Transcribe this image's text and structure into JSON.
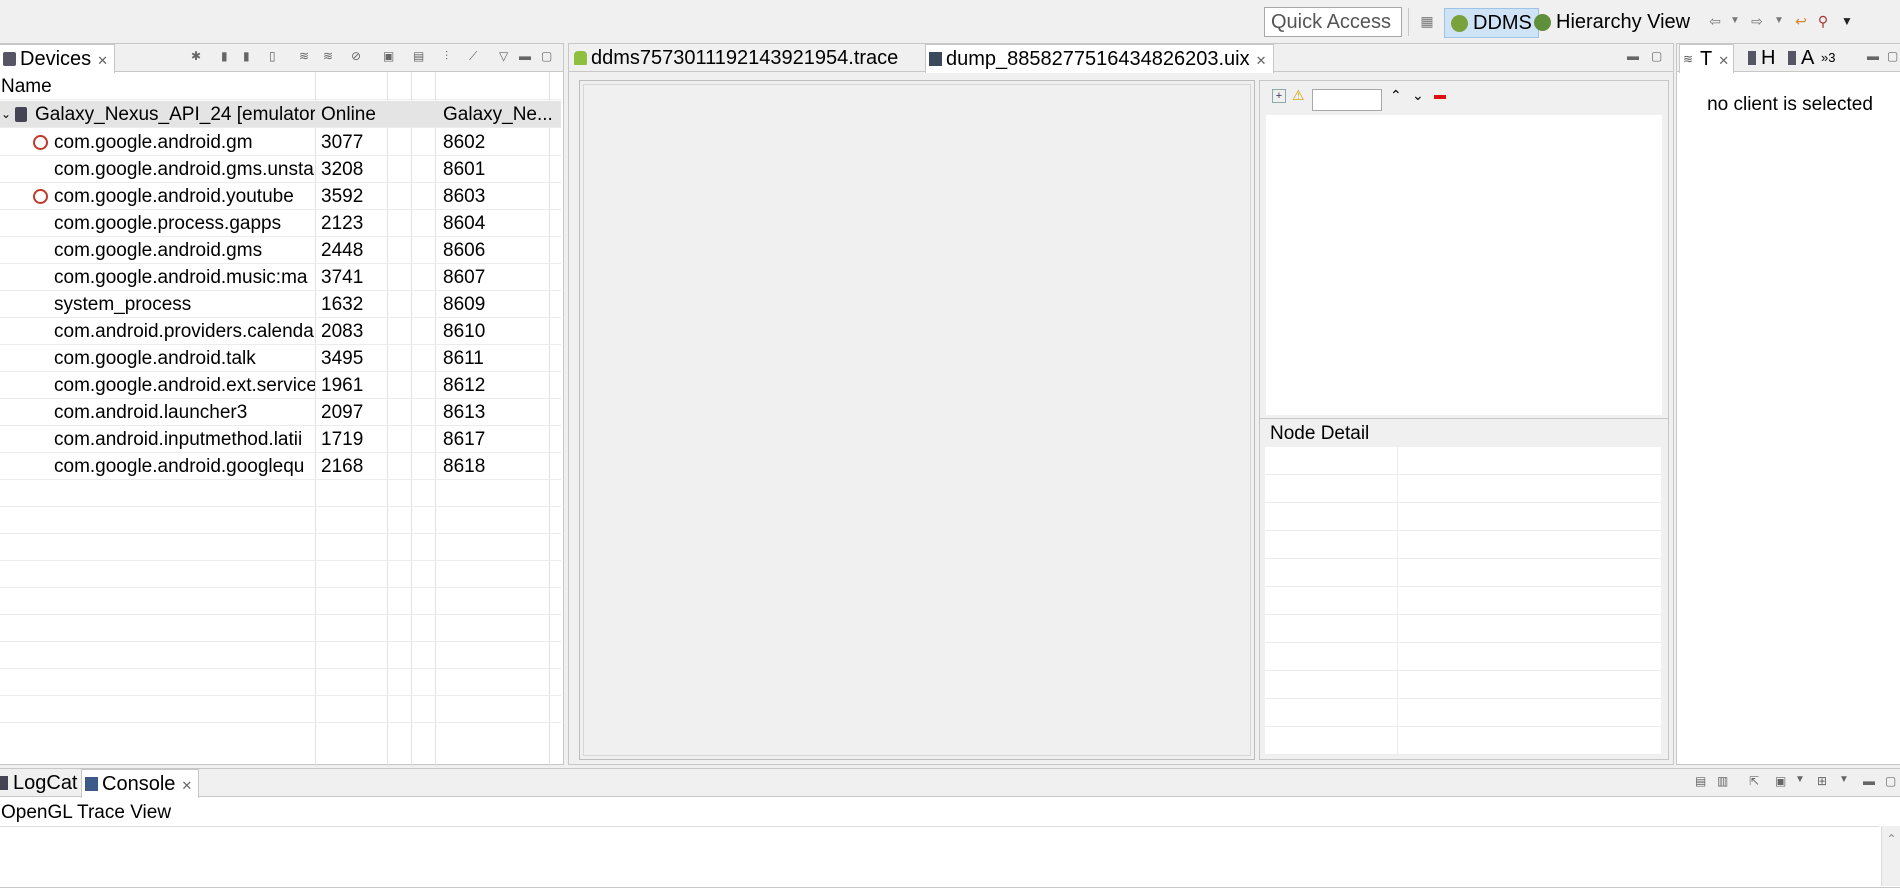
{
  "toolbar": {
    "quick_access": "Quick Access",
    "perspectives": [
      {
        "label": "DDMS",
        "active": true
      },
      {
        "label": "Hierarchy View",
        "active": false
      }
    ]
  },
  "devices": {
    "tab_label": "Devices",
    "column_header": "Name",
    "device": {
      "name": "Galaxy_Nexus_API_24 [emulator-",
      "status": "Online",
      "avd": "Galaxy_Ne..."
    },
    "processes": [
      {
        "name": "com.google.android.gm",
        "pid": "3077",
        "port": "8602",
        "debug": true
      },
      {
        "name": "com.google.android.gms.unsta",
        "pid": "3208",
        "port": "8601",
        "debug": false
      },
      {
        "name": "com.google.android.youtube",
        "pid": "3592",
        "port": "8603",
        "debug": true
      },
      {
        "name": "com.google.process.gapps",
        "pid": "2123",
        "port": "8604",
        "debug": false
      },
      {
        "name": "com.google.android.gms",
        "pid": "2448",
        "port": "8606",
        "debug": false
      },
      {
        "name": "com.google.android.music:ma",
        "pid": "3741",
        "port": "8607",
        "debug": false
      },
      {
        "name": "system_process",
        "pid": "1632",
        "port": "8609",
        "debug": false
      },
      {
        "name": "com.android.providers.calenda",
        "pid": "2083",
        "port": "8610",
        "debug": false
      },
      {
        "name": "com.google.android.talk",
        "pid": "3495",
        "port": "8611",
        "debug": false
      },
      {
        "name": "com.google.android.ext.service",
        "pid": "1961",
        "port": "8612",
        "debug": false
      },
      {
        "name": "com.android.launcher3",
        "pid": "2097",
        "port": "8613",
        "debug": false
      },
      {
        "name": "com.android.inputmethod.latii",
        "pid": "1719",
        "port": "8617",
        "debug": false
      },
      {
        "name": "com.google.android.googlequ",
        "pid": "2168",
        "port": "8618",
        "debug": false
      }
    ]
  },
  "editor": {
    "tabs": [
      {
        "label": "ddms7573011192143921954.trace",
        "active": false
      },
      {
        "label": "dump_8858277516434826203.uix",
        "active": true
      }
    ],
    "node_detail_title": "Node Detail"
  },
  "threads": {
    "tabs": [
      "T",
      "H",
      "A",
      "»3"
    ],
    "empty_message": "no client is selected"
  },
  "console": {
    "tabs": [
      {
        "label": "LogCat",
        "active": false
      },
      {
        "label": "Console",
        "active": true
      }
    ],
    "title": "OpenGL Trace View"
  },
  "colors": {
    "accent": "#cfe3f6",
    "device_row": "#e4e4e4",
    "debug_icon": "#c0392b"
  }
}
